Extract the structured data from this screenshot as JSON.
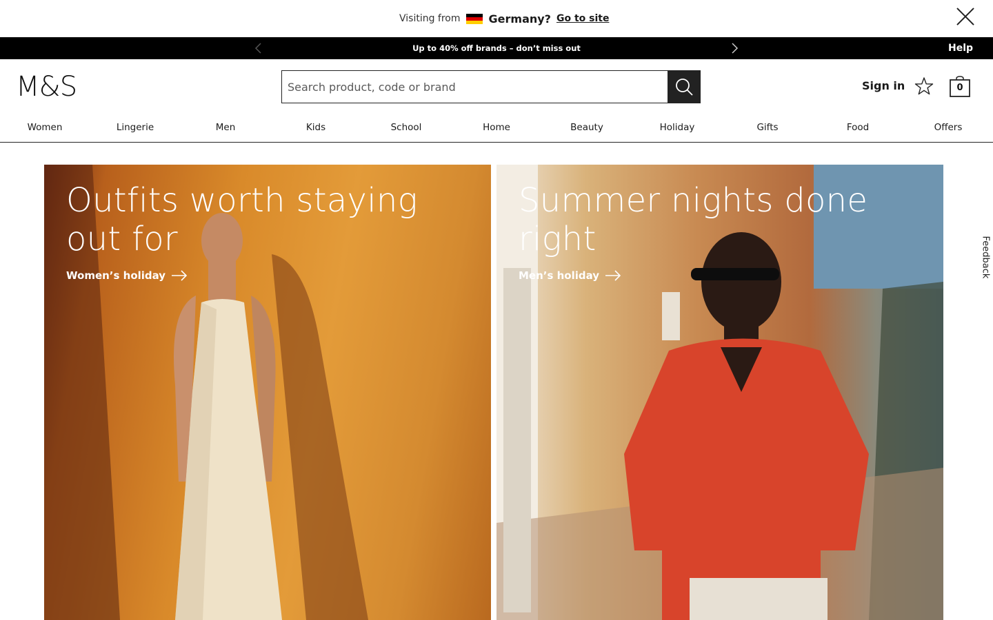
{
  "country_banner": {
    "visiting_label": "Visiting from",
    "country": "Germany?",
    "go_to_site": "Go to site",
    "flag_colors": [
      "#000000",
      "#dd0000",
      "#ffce00"
    ],
    "close_icon": "close-icon"
  },
  "promo": {
    "text": "Up to 40% off brands – don’t miss out",
    "prev_icon": "chevron-left-icon",
    "next_icon": "chevron-right-icon",
    "help": "Help"
  },
  "header": {
    "logo": "M&S",
    "search_placeholder": "Search product, code or brand",
    "search_icon": "search-icon",
    "sign_in": "Sign in",
    "wishlist_icon": "star-icon",
    "bag_count": "0"
  },
  "nav": {
    "items": [
      "Women",
      "Lingerie",
      "Men",
      "Kids",
      "School",
      "Home",
      "Beauty",
      "Holiday",
      "Gifts",
      "Food",
      "Offers"
    ]
  },
  "hero": {
    "left": {
      "title": "Outfits worth staying out for",
      "link": "Women’s holiday"
    },
    "right": {
      "title": "Summer nights done right",
      "link": "Men’s holiday"
    }
  },
  "feedback": "Feedback"
}
